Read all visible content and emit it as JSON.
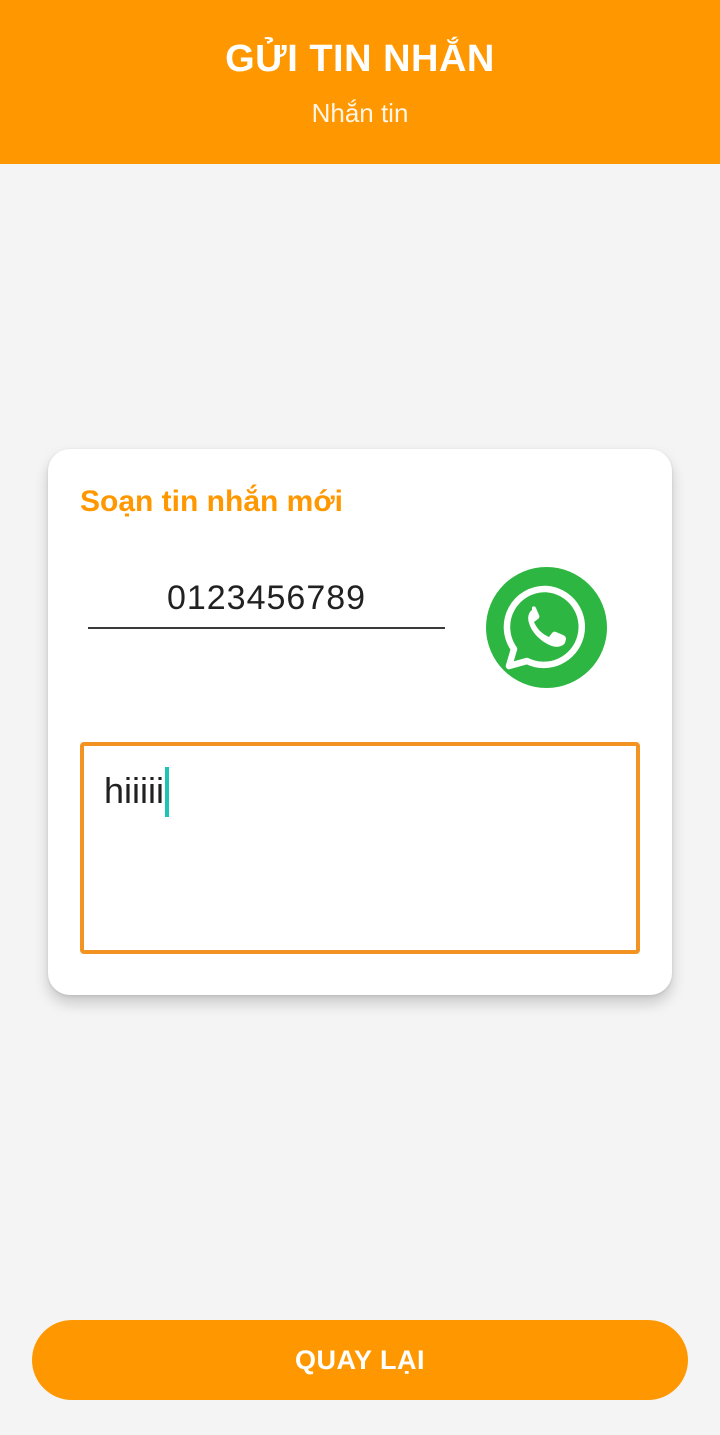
{
  "header": {
    "title": "GỬI TIN NHẮN",
    "subtitle": "Nhắn tin"
  },
  "compose": {
    "title": "Soạn tin nhắn mới",
    "phone_value": "0123456789",
    "message_value": "hiiiii",
    "send_icon": "whatsapp-icon"
  },
  "footer": {
    "back_label": "QUAY LẠI"
  },
  "colors": {
    "accent": "#ff9800",
    "background": "#f4f4f4",
    "whatsapp": "#2db742",
    "message_border": "#f39422",
    "caret": "#1fc3b4"
  }
}
